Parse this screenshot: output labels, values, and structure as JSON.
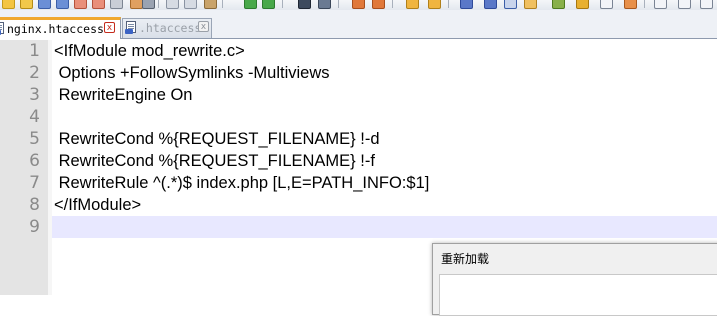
{
  "toolbar": {
    "icons": [
      "new-file-icon",
      "open-file-icon",
      "save-icon",
      "save-all-icon",
      "close-icon",
      "close-all-icon",
      "print-icon",
      "cut-icon",
      "copy-icon",
      "paste-icon",
      "undo-icon",
      "redo-icon",
      "find-icon",
      "replace-icon",
      "zoom-in-icon",
      "zoom-out-icon",
      "sync-scroll-icon",
      "word-wrap-icon",
      "show-all-chars-icon",
      "indent-guide-icon",
      "macro-record-icon",
      "macro-stop-icon",
      "macro-play-icon"
    ]
  },
  "tabs": [
    {
      "label": "nginx.htaccess",
      "close": "x",
      "active": true
    },
    {
      "label": ".htaccess",
      "close": "x",
      "active": false
    }
  ],
  "editor": {
    "line_numbers": [
      "1",
      "2",
      "3",
      "4",
      "5",
      "6",
      "7",
      "8",
      "9"
    ],
    "lines": [
      "<IfModule mod_rewrite.c>",
      " Options +FollowSymlinks -Multiviews",
      " RewriteEngine On",
      "",
      " RewriteCond %{REQUEST_FILENAME} !-d",
      " RewriteCond %{REQUEST_FILENAME} !-f",
      " RewriteRule ^(.*)$ index.php [L,E=PATH_INFO:$1]",
      "</IfModule>",
      ""
    ],
    "current_line": 9,
    "current_line_color": "#e8e8ff"
  },
  "dialog": {
    "title": "重新加载"
  },
  "colors": {
    "active_tab_accent": "#f0a82e",
    "gutter_bg": "#e4e4e4",
    "line_number": "#8a8a8a"
  }
}
